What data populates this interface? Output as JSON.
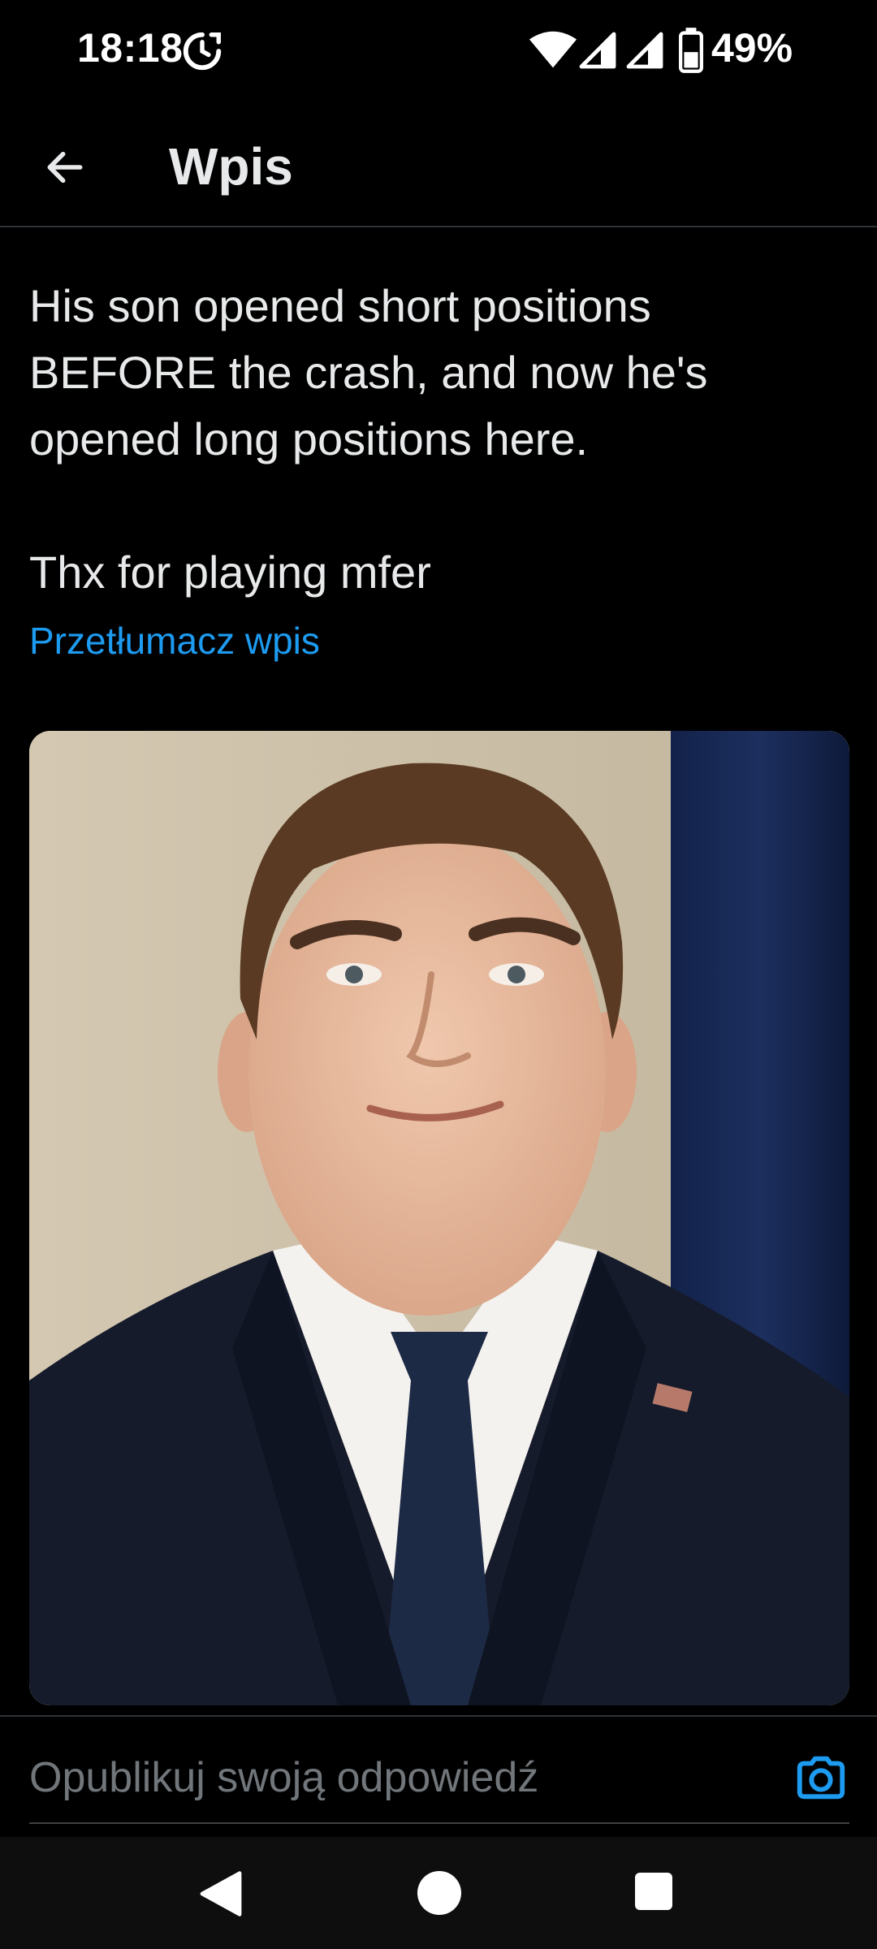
{
  "status_bar": {
    "time": "18:18",
    "battery": "49%",
    "icons": [
      "sync-icon",
      "wifi-icon",
      "signal-icon",
      "signal-icon",
      "battery-icon"
    ]
  },
  "header": {
    "back_icon": "arrow-left-icon",
    "title": "Wpis"
  },
  "post": {
    "text": "His son opened short positions BEFORE the crash, and now he's opened long positions here.\n\nThx for playing mfer",
    "translate_label": "Przetłumacz wpis",
    "image_alt": "Photo of a young man in a dark suit and tie with a small flag pin"
  },
  "reply": {
    "placeholder": "Opublikuj swoją odpowiedź",
    "camera_icon": "camera-icon"
  },
  "nav": {
    "back_icon": "triangle-back-icon",
    "home_icon": "circle-home-icon",
    "recents_icon": "square-recents-icon"
  },
  "colors": {
    "background": "#000000",
    "text": "#e7e9ea",
    "accent": "#1d9bf0",
    "muted": "#71767b",
    "divider": "#2f3336"
  }
}
